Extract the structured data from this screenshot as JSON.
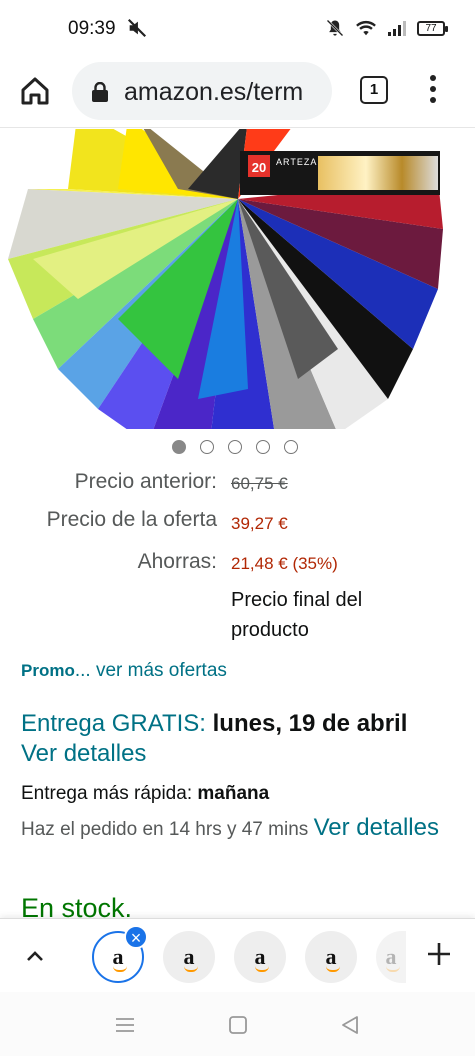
{
  "status_bar": {
    "time": "09:39",
    "battery": "77"
  },
  "browser": {
    "url": "amazon.es/term",
    "tab_count": "1"
  },
  "carousel": {
    "total": 5,
    "active": 0
  },
  "product_image": {
    "brand_badge": "20",
    "brand_name": "ARTEZA"
  },
  "pricing": {
    "previous_label": "Precio anterior:",
    "previous_value": "60,75 €",
    "offer_label": "Precio de la oferta",
    "offer_value": "39,27 €",
    "savings_label": "Ahorras:",
    "savings_value": "21,48 € (35%)",
    "final_note": "Precio final del producto"
  },
  "promo": {
    "label": "Promo",
    "link": "... ver más ofertas"
  },
  "delivery": {
    "free_label": "Entrega GRATIS:",
    "date": "lunes, 19 de abril",
    "details_link": "Ver detalles",
    "fastest_label": "Entrega más rápida:",
    "fastest_value": "mañana",
    "order_text": "Haz el pedido en 14 hrs y 47 mins",
    "order_link": "Ver detalles"
  },
  "stock": "En stock.",
  "tab_strip": {
    "tab_letter": "a",
    "colors": {
      "active_border": "#1a73e8",
      "amazon_orange": "#ff9900"
    }
  },
  "colors": {
    "link": "#007185",
    "price_red": "#b12704",
    "stock_green": "#007600"
  }
}
